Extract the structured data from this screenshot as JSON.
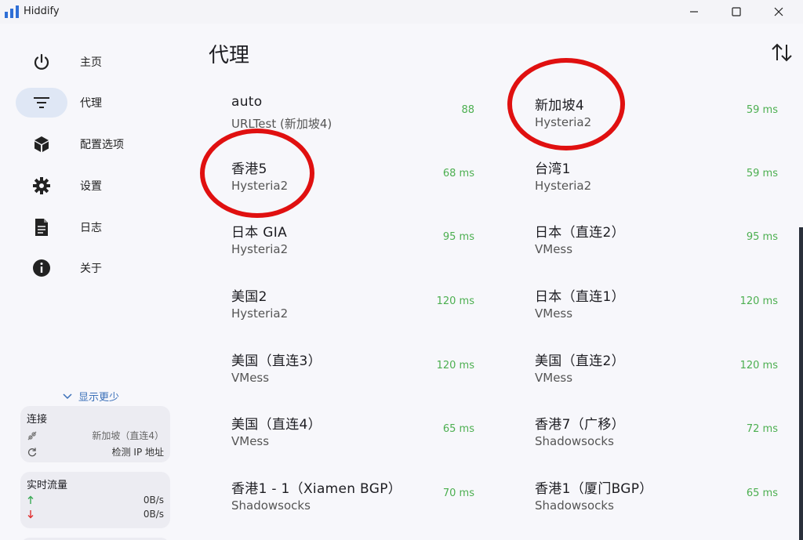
{
  "window": {
    "title": "Hiddify"
  },
  "sidebar": {
    "items": [
      {
        "label": "主页",
        "icon": "power-icon"
      },
      {
        "label": "代理",
        "icon": "filter-icon",
        "active": true
      },
      {
        "label": "配置选项",
        "icon": "box-icon"
      },
      {
        "label": "设置",
        "icon": "gear-icon"
      },
      {
        "label": "日志",
        "icon": "document-icon"
      },
      {
        "label": "关于",
        "icon": "info-icon"
      }
    ],
    "show_less": "显示更少",
    "connection": {
      "title": "连接",
      "outbound": "新加坡（直连4）",
      "check_ip": "检测 IP 地址"
    },
    "traffic": {
      "title": "实时流量",
      "upload": "0B/s",
      "download": "0B/s"
    }
  },
  "main": {
    "title": "代理",
    "proxies": [
      {
        "name": "auto",
        "type": "URLTest (新加坡4)",
        "delay": "88"
      },
      {
        "name": "新加坡4",
        "type": "Hysteria2",
        "delay": "59 ms"
      },
      {
        "name": "香港5",
        "type": "Hysteria2",
        "delay": "68 ms"
      },
      {
        "name": "台湾1",
        "type": "Hysteria2",
        "delay": "59 ms"
      },
      {
        "name": "日本 GIA",
        "type": "Hysteria2",
        "delay": "95 ms"
      },
      {
        "name": "日本（直连2）",
        "type": "VMess",
        "delay": "95 ms"
      },
      {
        "name": "美国2",
        "type": "Hysteria2",
        "delay": "120 ms"
      },
      {
        "name": "日本（直连1）",
        "type": "VMess",
        "delay": "120 ms"
      },
      {
        "name": "美国（直连3）",
        "type": "VMess",
        "delay": "120 ms"
      },
      {
        "name": "美国（直连2）",
        "type": "VMess",
        "delay": "120 ms"
      },
      {
        "name": "美国（直连4）",
        "type": "VMess",
        "delay": "65 ms"
      },
      {
        "name": "香港7（广移）",
        "type": "Shadowsocks",
        "delay": "72 ms"
      },
      {
        "name": "香港1 - 1（Xiamen BGP）",
        "type": "Shadowsocks",
        "delay": "70 ms"
      },
      {
        "name": "香港1（厦门BGP）",
        "type": "Shadowsocks",
        "delay": "65 ms"
      }
    ]
  },
  "colors": {
    "delay": "#4caf50",
    "annotation": "#e01010",
    "accent": "#2f6fd6"
  }
}
